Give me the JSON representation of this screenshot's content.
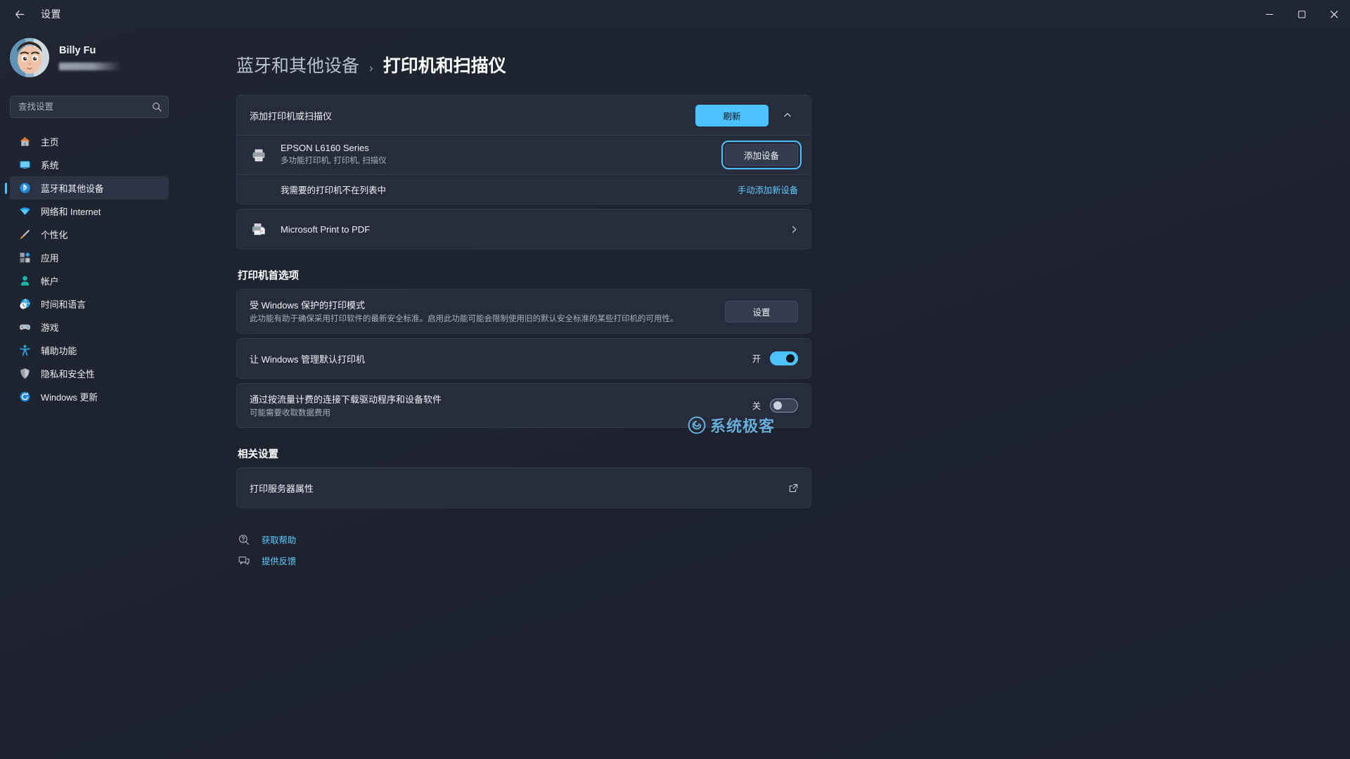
{
  "window": {
    "title": "设置",
    "back_icon": "back-arrow-icon",
    "minimize": "—",
    "maximize": "▢",
    "close": "✕"
  },
  "account": {
    "name": "Billy Fu",
    "email_redacted": ""
  },
  "search": {
    "placeholder": "查找设置",
    "value": "",
    "icon": "search-icon"
  },
  "sidebar": {
    "items": [
      {
        "label": "主页",
        "icon": "home-icon",
        "active": false
      },
      {
        "label": "系统",
        "icon": "system-icon",
        "active": false
      },
      {
        "label": "蓝牙和其他设备",
        "icon": "bluetooth-icon",
        "active": true
      },
      {
        "label": "网络和 Internet",
        "icon": "network-icon",
        "active": false
      },
      {
        "label": "个性化",
        "icon": "personalization-icon",
        "active": false
      },
      {
        "label": "应用",
        "icon": "apps-icon",
        "active": false
      },
      {
        "label": "帐户",
        "icon": "accounts-icon",
        "active": false
      },
      {
        "label": "时间和语言",
        "icon": "time-language-icon",
        "active": false
      },
      {
        "label": "游戏",
        "icon": "gaming-icon",
        "active": false
      },
      {
        "label": "辅助功能",
        "icon": "accessibility-icon",
        "active": false
      },
      {
        "label": "隐私和安全性",
        "icon": "privacy-security-icon",
        "active": false
      },
      {
        "label": "Windows 更新",
        "icon": "windows-update-icon",
        "active": false
      }
    ]
  },
  "breadcrumb": {
    "parent": "蓝牙和其他设备",
    "separator": "›",
    "current": "打印机和扫描仪"
  },
  "add_printer": {
    "title": "添加打印机或扫描仪",
    "refresh_button": "刷新",
    "collapse_icon": "chevron-up-icon",
    "discovered": {
      "name": "EPSON L6160 Series",
      "subtitle": "多功能打印机, 打印机, 扫描仪",
      "icon": "printer-icon",
      "add_button": "添加设备"
    },
    "not_listed": {
      "label": "我需要的打印机不在列表中",
      "action": "手动添加新设备"
    }
  },
  "installed": {
    "name": "Microsoft Print to PDF",
    "icon": "print-to-pdf-icon",
    "chevron": "›"
  },
  "preferences": {
    "section_title": "打印机首选项",
    "protected_mode": {
      "title": "受 Windows 保护的打印模式",
      "desc": "此功能有助于确保采用打印软件的最新安全标准。启用此功能可能会限制使用旧的默认安全标准的某些打印机的可用性。",
      "button": "设置"
    },
    "manage_default": {
      "title": "让 Windows 管理默认打印机",
      "state": "开",
      "on": true
    },
    "metered_download": {
      "title": "通过按流量计费的连接下载驱动程序和设备软件",
      "desc": "可能需要收取数据费用",
      "state": "关",
      "on": false
    }
  },
  "related": {
    "section_title": "相关设置",
    "server_properties": {
      "label": "打印服务器属性",
      "icon": "external-link-icon"
    }
  },
  "footer": {
    "help": {
      "label": "获取帮助",
      "icon": "help-icon"
    },
    "feedback": {
      "label": "提供反馈",
      "icon": "feedback-icon"
    }
  },
  "watermark": {
    "text": "系统极客",
    "icon": "spiral-logo-icon"
  },
  "colors": {
    "accent": "#4cc2ff",
    "card": "#262c3b",
    "background": "#1f2430"
  }
}
